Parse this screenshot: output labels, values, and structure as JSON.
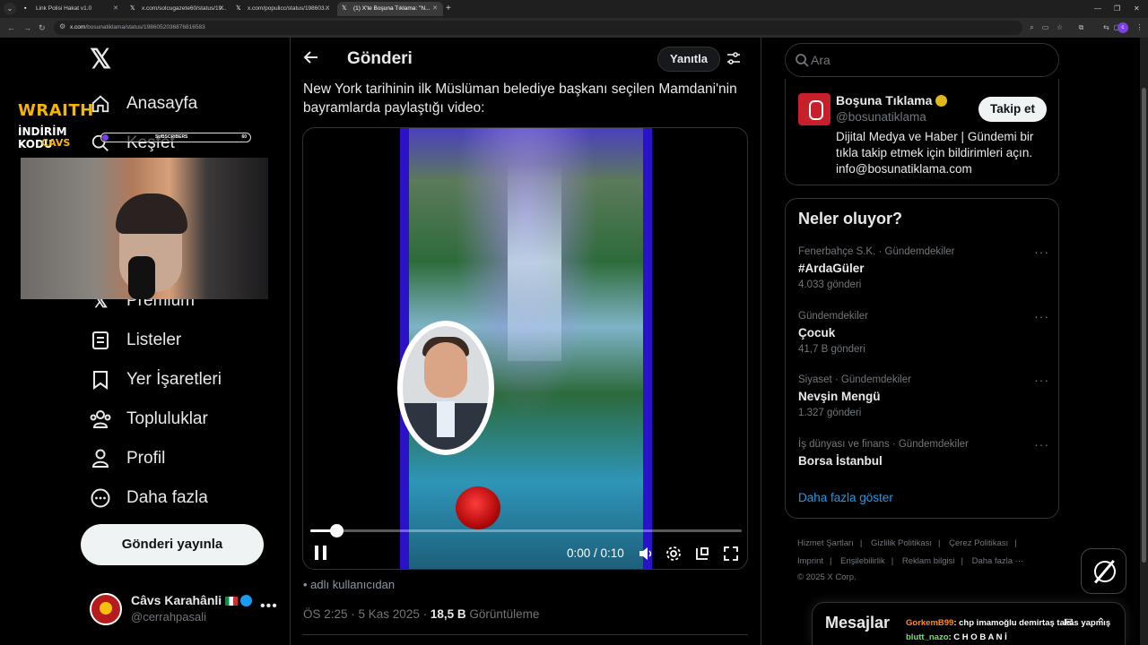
{
  "browser": {
    "tabs": [
      {
        "label": "Link Polisi Hakat v1.0",
        "icon": "page-icon"
      },
      {
        "label": "x.com/solcugazete60/status/19...",
        "icon": "x-icon"
      },
      {
        "label": "x.com/populicc/status/198603...",
        "icon": "x-icon"
      },
      {
        "label": "(1) X'te Boşuna Tıklama: \"N...",
        "icon": "x-icon"
      }
    ],
    "url_host": "x.com",
    "url_path": "/bosunatiklama/status/1986052036876816583"
  },
  "stream_overlay": {
    "brand": "WRAITH",
    "code_line": "İNDİRİM KODU",
    "code": "CAVS",
    "subs_label": "SUBSCRIBERS",
    "subs_value": "60"
  },
  "sidebar": {
    "items": [
      {
        "label": "Anasayfa",
        "icon": "home-icon"
      },
      {
        "label": "Keşfet",
        "icon": "search-icon"
      },
      {
        "label": "Premium",
        "icon": "x-icon"
      },
      {
        "label": "Listeler",
        "icon": "list-icon"
      },
      {
        "label": "Yer İşaretleri",
        "icon": "bookmark-icon"
      },
      {
        "label": "Topluluklar",
        "icon": "communities-icon"
      },
      {
        "label": "Profil",
        "icon": "profile-icon"
      },
      {
        "label": "Daha fazla",
        "icon": "more-icon"
      }
    ],
    "post_button": "Gönderi yayınla",
    "account": {
      "name": "Câvs Karahânli",
      "handle": "@cerrahpasali",
      "more": "•••"
    }
  },
  "main": {
    "title": "Gönderi",
    "reply_button": "Yanıtla",
    "text": "New York tarihinin ilk Müslüman belediye başkanı seçilen Mamdani'nin bayramlarda paylaştığı video:",
    "video": {
      "time": "0:00 / 0:10",
      "progress": 0.06
    },
    "note": "adlı kullanıcıdan",
    "time_date": "ÖS 2:25 · 5 Kas 2025 · ",
    "views_value": "18,5 B",
    "views_label": " Görüntüleme"
  },
  "right": {
    "search_placeholder": "Ara",
    "profile_card": {
      "name": "Boşuna Tıklama",
      "handle": "@bosunatiklama",
      "follow": "Takip et",
      "bio": "Dijital Medya ve Haber | Gündemi bir tıkla takip etmek için bildirimleri açın. info@bosunatiklama.com"
    },
    "trends_title": "Neler oluyor?",
    "trends": [
      {
        "category": "Fenerbahçe S.K. · Gündemdekiler",
        "name": "#ArdaGüler",
        "count": "4.033 gönderi"
      },
      {
        "category": "Gündemdekiler",
        "name": "Çocuk",
        "count": "41,7 B gönderi"
      },
      {
        "category": "Siyaset · Gündemdekiler",
        "name": "Nevşin Mengü",
        "count": "1.327 gönderi"
      },
      {
        "category": "İş dünyası ve finans · Gündemdekiler",
        "name": "Borsa İstanbul",
        "count": ""
      }
    ],
    "show_more": "Daha fazla göster",
    "footer": [
      "Hizmet Şartları",
      "Gizlilik Politikası",
      "Çerez Politikası",
      "Imprint",
      "Erişilebilirlik",
      "Reklam bilgisi",
      "Daha fazla ···",
      "© 2025 X Corp."
    ],
    "messages_title": "Mesajlar"
  },
  "chat": [
    {
      "user": "GorkemB99",
      "text": ": chp imamoğlu demirtaş takas yapmış"
    },
    {
      "user": "blutt_nazo",
      "text": ": C H O B A N İ"
    }
  ]
}
